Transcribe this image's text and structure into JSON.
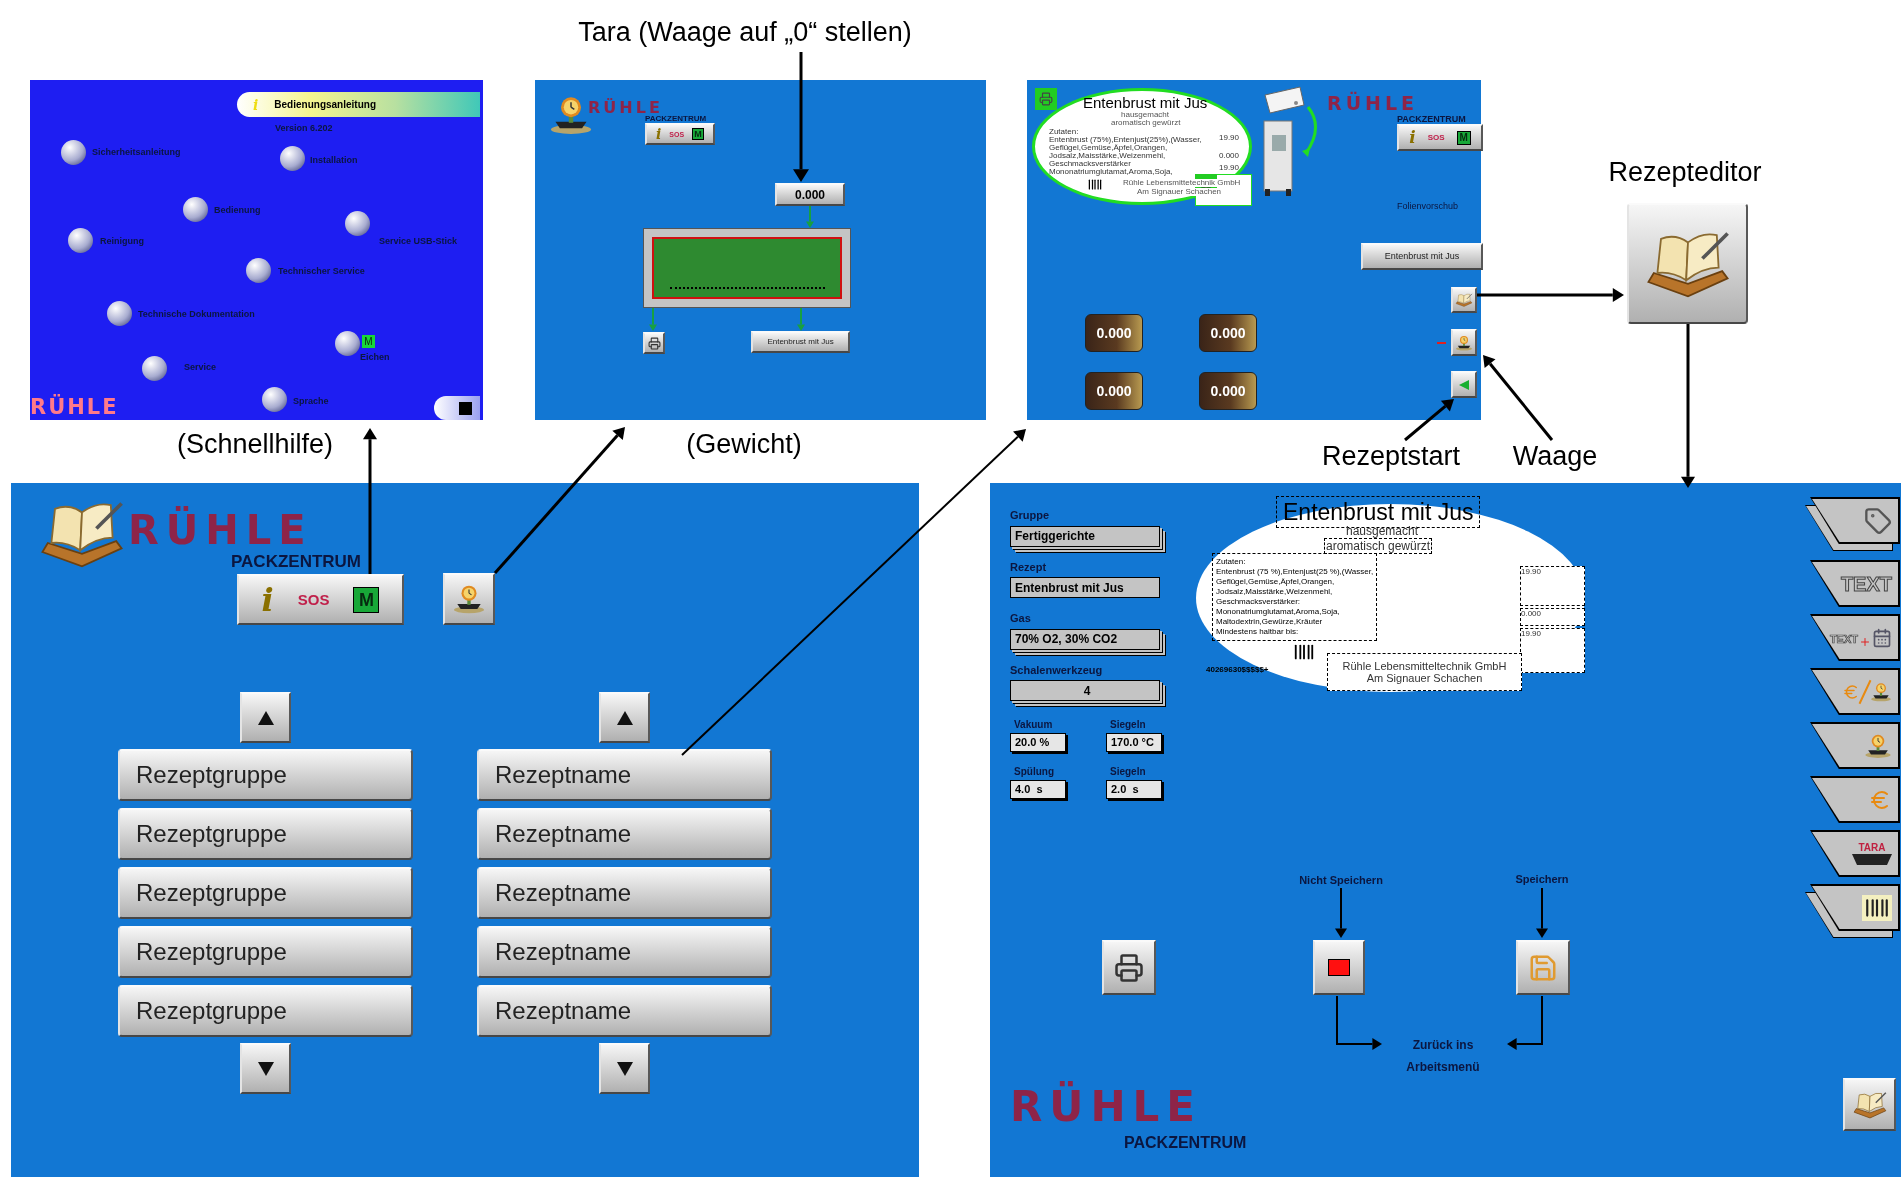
{
  "annotations": [
    {
      "text": "Tara (Waage auf „0“ stellen)"
    },
    {
      "text": "(Schnellhilfe)"
    },
    {
      "text": "(Gewicht)"
    },
    {
      "text": "Rezepteditor"
    },
    {
      "text": "Rezeptstart"
    },
    {
      "text": "Waage"
    }
  ],
  "help_screen": {
    "title": "Bedienungsanleitung",
    "info": "i",
    "version": "Version 6.202",
    "logo": "RÜHLE",
    "topics": [
      {
        "label": "Sicherheitsanleitung"
      },
      {
        "label": "Installation"
      },
      {
        "label": "Bedienung"
      },
      {
        "label": "Reinigung"
      },
      {
        "label": "Service USB-Stick"
      },
      {
        "label": "Technischer Service"
      },
      {
        "label": "Technische Dokumentation"
      },
      {
        "label": "Eichen",
        "badge": "M"
      },
      {
        "label": "Service"
      },
      {
        "label": "Sprache"
      }
    ]
  },
  "weight_screen": {
    "logo": "RÜHLE",
    "subtitle": "PACKZENTRUM",
    "toolbar": {
      "info": "i",
      "sos": "SOS",
      "m": "M"
    },
    "tare_value": "0.000",
    "recipe_button": "Entenbrust mit Jus"
  },
  "run_screen": {
    "label": {
      "title": "Entenbrust mit Jus",
      "line1": "hausgemacht",
      "line2": "aromatisch gewürzt",
      "ingredients": [
        "Zutaten:",
        "Entenbrust (75%),Entenjust(25%),(Wasser,",
        "Geflügel,Gemüse,Äpfel,Orangen,",
        "Jodsalz,Maisstärke,Weizenmehl,",
        "Geschmacksverstärker",
        "Mononatriumglutamat,Aroma,Soja,"
      ],
      "prices": [
        "19.90",
        "0.000",
        "19.90"
      ],
      "company": "Rühle Lebensmittetechnik GmbH",
      "address": "Am Signauer Schachen"
    },
    "logo": "RÜHLE",
    "subtitle": "PACKZENTRUM",
    "toolbar": {
      "info": "i",
      "sos": "SOS",
      "m": "M"
    },
    "film_feed": "Folienvorschub",
    "recipe_button": "Entenbrust mit Jus",
    "weights": [
      {
        "value": "0.000"
      },
      {
        "value": "0.000"
      },
      {
        "value": "0.000"
      },
      {
        "value": "0.000"
      }
    ]
  },
  "recipe_screen": {
    "logo": "RÜHLE",
    "subtitle": "PACKZENTRUM",
    "toolbar": {
      "info": "i",
      "sos": "SOS",
      "m": "M"
    },
    "groups": [
      {
        "label": "Rezeptgruppe"
      },
      {
        "label": "Rezeptgruppe"
      },
      {
        "label": "Rezeptgruppe"
      },
      {
        "label": "Rezeptgruppe"
      },
      {
        "label": "Rezeptgruppe"
      }
    ],
    "names": [
      {
        "label": "Rezeptname"
      },
      {
        "label": "Rezeptname"
      },
      {
        "label": "Rezeptname"
      },
      {
        "label": "Rezeptname"
      },
      {
        "label": "Rezeptname"
      }
    ]
  },
  "editor_screen": {
    "fields": [
      {
        "label": "Gruppe",
        "value": "Fertiggerichte",
        "stacked": true
      },
      {
        "label": "Rezept",
        "value": "Entenbrust mit Jus",
        "stacked": false
      },
      {
        "label": "Gas",
        "value": "70% O2, 30% CO2",
        "stacked": true
      },
      {
        "label": "Schalenwerkzeug",
        "value": "4",
        "stacked": true
      }
    ],
    "params": [
      {
        "label": "Vakuum",
        "value": "20.0 %"
      },
      {
        "label": "Siegeln",
        "value": "170.0 °C"
      },
      {
        "label": "Spülung",
        "value": "4.0  s"
      },
      {
        "label": "Siegeln",
        "value": "2.0  s"
      }
    ],
    "label": {
      "title": "Entenbrust mit Jus",
      "line1": "hausgemacht",
      "line2": "aromatisch gewürzt",
      "ingredients": [
        "Zutaten:",
        "Entenbrust (75 %),Entenjust(25 %),(Wasser,",
        "Geflügel,Gemüse,Äpfel,Orangen,",
        "Jodsalz,Maisstärke,Weizenmehl,",
        "Geschmacksverstärker:",
        "Mononatriumglutamat,Aroma,Soja,",
        "Maltodextrin,Gewürze,Kräuter",
        "Mindestens haltbar bis:"
      ],
      "barcode_number": "40269630$$$$$+",
      "prices": [
        "19.90",
        "0.000",
        "19.90"
      ],
      "company": "Rühle Lebensmitteltechnik GmbH",
      "address": "Am Signauer Schachen"
    },
    "tools": [
      {
        "kind": "tag"
      },
      {
        "kind": "text",
        "text": "TEXT"
      },
      {
        "kind": "text-date",
        "text": "TEXT"
      },
      {
        "kind": "price-weight"
      },
      {
        "kind": "weight"
      },
      {
        "kind": "price"
      },
      {
        "kind": "tare",
        "text": "TARA"
      },
      {
        "kind": "barcode"
      }
    ],
    "discard_label": "Nicht Speichern",
    "save_label": "Speichern",
    "return_label": "Zurück ins Arbeitsmenü",
    "logo": "RÜHLE",
    "subtitle": "PACKZENTRUM"
  }
}
